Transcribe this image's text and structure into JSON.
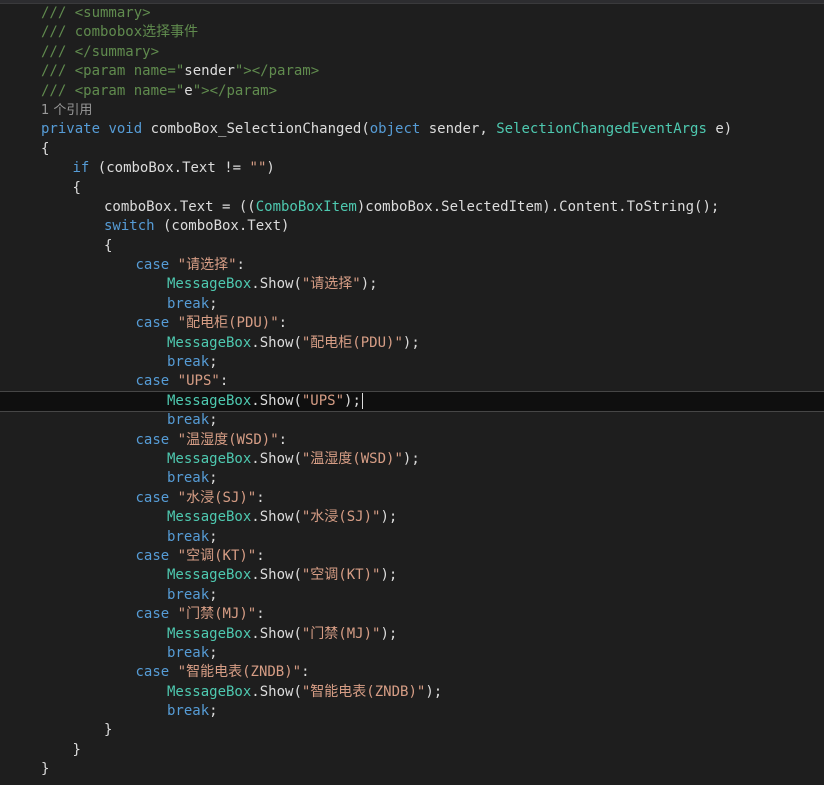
{
  "colors": {
    "background": "#1e1e1e",
    "comment": "#57a64a",
    "keyword": "#569cd6",
    "type": "#4ec9b0",
    "string": "#d69d85",
    "text": "#dcdcdc",
    "codelens": "#999999"
  },
  "current_line_index": 20,
  "lines": [
    {
      "indent": 0,
      "tokens": [
        {
          "c": "doc",
          "t": "/// <summary>"
        }
      ]
    },
    {
      "indent": 0,
      "tokens": [
        {
          "c": "doc",
          "t": "/// combobox选择事件"
        }
      ]
    },
    {
      "indent": 0,
      "tokens": [
        {
          "c": "doc",
          "t": "/// </summary>"
        }
      ]
    },
    {
      "indent": 0,
      "tokens": [
        {
          "c": "doc",
          "t": "/// <param name=\""
        },
        {
          "c": "plain",
          "t": "sender"
        },
        {
          "c": "doc",
          "t": "\"></param>"
        }
      ]
    },
    {
      "indent": 0,
      "tokens": [
        {
          "c": "doc",
          "t": "/// <param name=\""
        },
        {
          "c": "plain",
          "t": "e"
        },
        {
          "c": "doc",
          "t": "\"></param>"
        }
      ]
    },
    {
      "indent": 0,
      "tokens": [
        {
          "c": "codelens",
          "t": "1 个引用"
        }
      ]
    },
    {
      "indent": 0,
      "tokens": [
        {
          "c": "kw",
          "t": "private"
        },
        {
          "c": "plain",
          "t": " "
        },
        {
          "c": "kw",
          "t": "void"
        },
        {
          "c": "plain",
          "t": " comboBox_SelectionChanged("
        },
        {
          "c": "kw",
          "t": "object"
        },
        {
          "c": "plain",
          "t": " sender, "
        },
        {
          "c": "type",
          "t": "SelectionChangedEventArgs"
        },
        {
          "c": "plain",
          "t": " e)"
        }
      ]
    },
    {
      "indent": 0,
      "tokens": [
        {
          "c": "plain",
          "t": "{"
        }
      ]
    },
    {
      "indent": 1,
      "tokens": [
        {
          "c": "kw",
          "t": "if"
        },
        {
          "c": "plain",
          "t": " (comboBox.Text != "
        },
        {
          "c": "str",
          "t": "\"\""
        },
        {
          "c": "plain",
          "t": ")"
        }
      ]
    },
    {
      "indent": 1,
      "tokens": [
        {
          "c": "plain",
          "t": "{"
        }
      ]
    },
    {
      "indent": 2,
      "tokens": [
        {
          "c": "plain",
          "t": "comboBox.Text = (("
        },
        {
          "c": "type",
          "t": "ComboBoxItem"
        },
        {
          "c": "plain",
          "t": ")comboBox.SelectedItem).Content.ToString();"
        }
      ]
    },
    {
      "indent": 2,
      "tokens": [
        {
          "c": "kw",
          "t": "switch"
        },
        {
          "c": "plain",
          "t": " (comboBox.Text)"
        }
      ]
    },
    {
      "indent": 2,
      "tokens": [
        {
          "c": "plain",
          "t": "{"
        }
      ]
    },
    {
      "indent": 3,
      "tokens": [
        {
          "c": "kw",
          "t": "case"
        },
        {
          "c": "plain",
          "t": " "
        },
        {
          "c": "str",
          "t": "\"请选择\""
        },
        {
          "c": "plain",
          "t": ":"
        }
      ]
    },
    {
      "indent": 4,
      "tokens": [
        {
          "c": "type",
          "t": "MessageBox"
        },
        {
          "c": "plain",
          "t": ".Show("
        },
        {
          "c": "str",
          "t": "\"请选择\""
        },
        {
          "c": "plain",
          "t": ");"
        }
      ]
    },
    {
      "indent": 4,
      "tokens": [
        {
          "c": "kw",
          "t": "break"
        },
        {
          "c": "plain",
          "t": ";"
        }
      ]
    },
    {
      "indent": 3,
      "tokens": [
        {
          "c": "kw",
          "t": "case"
        },
        {
          "c": "plain",
          "t": " "
        },
        {
          "c": "str",
          "t": "\"配电柜(PDU)\""
        },
        {
          "c": "plain",
          "t": ":"
        }
      ]
    },
    {
      "indent": 4,
      "tokens": [
        {
          "c": "type",
          "t": "MessageBox"
        },
        {
          "c": "plain",
          "t": ".Show("
        },
        {
          "c": "str",
          "t": "\"配电柜(PDU)\""
        },
        {
          "c": "plain",
          "t": ");"
        }
      ]
    },
    {
      "indent": 4,
      "tokens": [
        {
          "c": "kw",
          "t": "break"
        },
        {
          "c": "plain",
          "t": ";"
        }
      ]
    },
    {
      "indent": 3,
      "tokens": [
        {
          "c": "kw",
          "t": "case"
        },
        {
          "c": "plain",
          "t": " "
        },
        {
          "c": "str",
          "t": "\"UPS\""
        },
        {
          "c": "plain",
          "t": ":"
        }
      ]
    },
    {
      "indent": 4,
      "tokens": [
        {
          "c": "type",
          "t": "MessageBox"
        },
        {
          "c": "plain",
          "t": ".Show("
        },
        {
          "c": "str",
          "t": "\"UPS\""
        },
        {
          "c": "plain",
          "t": ");"
        }
      ]
    },
    {
      "indent": 4,
      "tokens": [
        {
          "c": "kw",
          "t": "break"
        },
        {
          "c": "plain",
          "t": ";"
        }
      ]
    },
    {
      "indent": 3,
      "tokens": [
        {
          "c": "kw",
          "t": "case"
        },
        {
          "c": "plain",
          "t": " "
        },
        {
          "c": "str",
          "t": "\"温湿度(WSD)\""
        },
        {
          "c": "plain",
          "t": ":"
        }
      ]
    },
    {
      "indent": 4,
      "tokens": [
        {
          "c": "type",
          "t": "MessageBox"
        },
        {
          "c": "plain",
          "t": ".Show("
        },
        {
          "c": "str",
          "t": "\"温湿度(WSD)\""
        },
        {
          "c": "plain",
          "t": ");"
        }
      ]
    },
    {
      "indent": 4,
      "tokens": [
        {
          "c": "kw",
          "t": "break"
        },
        {
          "c": "plain",
          "t": ";"
        }
      ]
    },
    {
      "indent": 3,
      "tokens": [
        {
          "c": "kw",
          "t": "case"
        },
        {
          "c": "plain",
          "t": " "
        },
        {
          "c": "str",
          "t": "\"水浸(SJ)\""
        },
        {
          "c": "plain",
          "t": ":"
        }
      ]
    },
    {
      "indent": 4,
      "tokens": [
        {
          "c": "type",
          "t": "MessageBox"
        },
        {
          "c": "plain",
          "t": ".Show("
        },
        {
          "c": "str",
          "t": "\"水浸(SJ)\""
        },
        {
          "c": "plain",
          "t": ");"
        }
      ]
    },
    {
      "indent": 4,
      "tokens": [
        {
          "c": "kw",
          "t": "break"
        },
        {
          "c": "plain",
          "t": ";"
        }
      ]
    },
    {
      "indent": 3,
      "tokens": [
        {
          "c": "kw",
          "t": "case"
        },
        {
          "c": "plain",
          "t": " "
        },
        {
          "c": "str",
          "t": "\"空调(KT)\""
        },
        {
          "c": "plain",
          "t": ":"
        }
      ]
    },
    {
      "indent": 4,
      "tokens": [
        {
          "c": "type",
          "t": "MessageBox"
        },
        {
          "c": "plain",
          "t": ".Show("
        },
        {
          "c": "str",
          "t": "\"空调(KT)\""
        },
        {
          "c": "plain",
          "t": ");"
        }
      ]
    },
    {
      "indent": 4,
      "tokens": [
        {
          "c": "kw",
          "t": "break"
        },
        {
          "c": "plain",
          "t": ";"
        }
      ]
    },
    {
      "indent": 3,
      "tokens": [
        {
          "c": "kw",
          "t": "case"
        },
        {
          "c": "plain",
          "t": " "
        },
        {
          "c": "str",
          "t": "\"门禁(MJ)\""
        },
        {
          "c": "plain",
          "t": ":"
        }
      ]
    },
    {
      "indent": 4,
      "tokens": [
        {
          "c": "type",
          "t": "MessageBox"
        },
        {
          "c": "plain",
          "t": ".Show("
        },
        {
          "c": "str",
          "t": "\"门禁(MJ)\""
        },
        {
          "c": "plain",
          "t": ");"
        }
      ]
    },
    {
      "indent": 4,
      "tokens": [
        {
          "c": "kw",
          "t": "break"
        },
        {
          "c": "plain",
          "t": ";"
        }
      ]
    },
    {
      "indent": 3,
      "tokens": [
        {
          "c": "kw",
          "t": "case"
        },
        {
          "c": "plain",
          "t": " "
        },
        {
          "c": "str",
          "t": "\"智能电表(ZNDB)\""
        },
        {
          "c": "plain",
          "t": ":"
        }
      ]
    },
    {
      "indent": 4,
      "tokens": [
        {
          "c": "type",
          "t": "MessageBox"
        },
        {
          "c": "plain",
          "t": ".Show("
        },
        {
          "c": "str",
          "t": "\"智能电表(ZNDB)\""
        },
        {
          "c": "plain",
          "t": ");"
        }
      ]
    },
    {
      "indent": 4,
      "tokens": [
        {
          "c": "kw",
          "t": "break"
        },
        {
          "c": "plain",
          "t": ";"
        }
      ]
    },
    {
      "indent": 2,
      "tokens": [
        {
          "c": "plain",
          "t": "}"
        }
      ]
    },
    {
      "indent": 1,
      "tokens": [
        {
          "c": "plain",
          "t": "}"
        }
      ]
    },
    {
      "indent": 0,
      "tokens": [
        {
          "c": "plain",
          "t": "}"
        }
      ]
    }
  ]
}
